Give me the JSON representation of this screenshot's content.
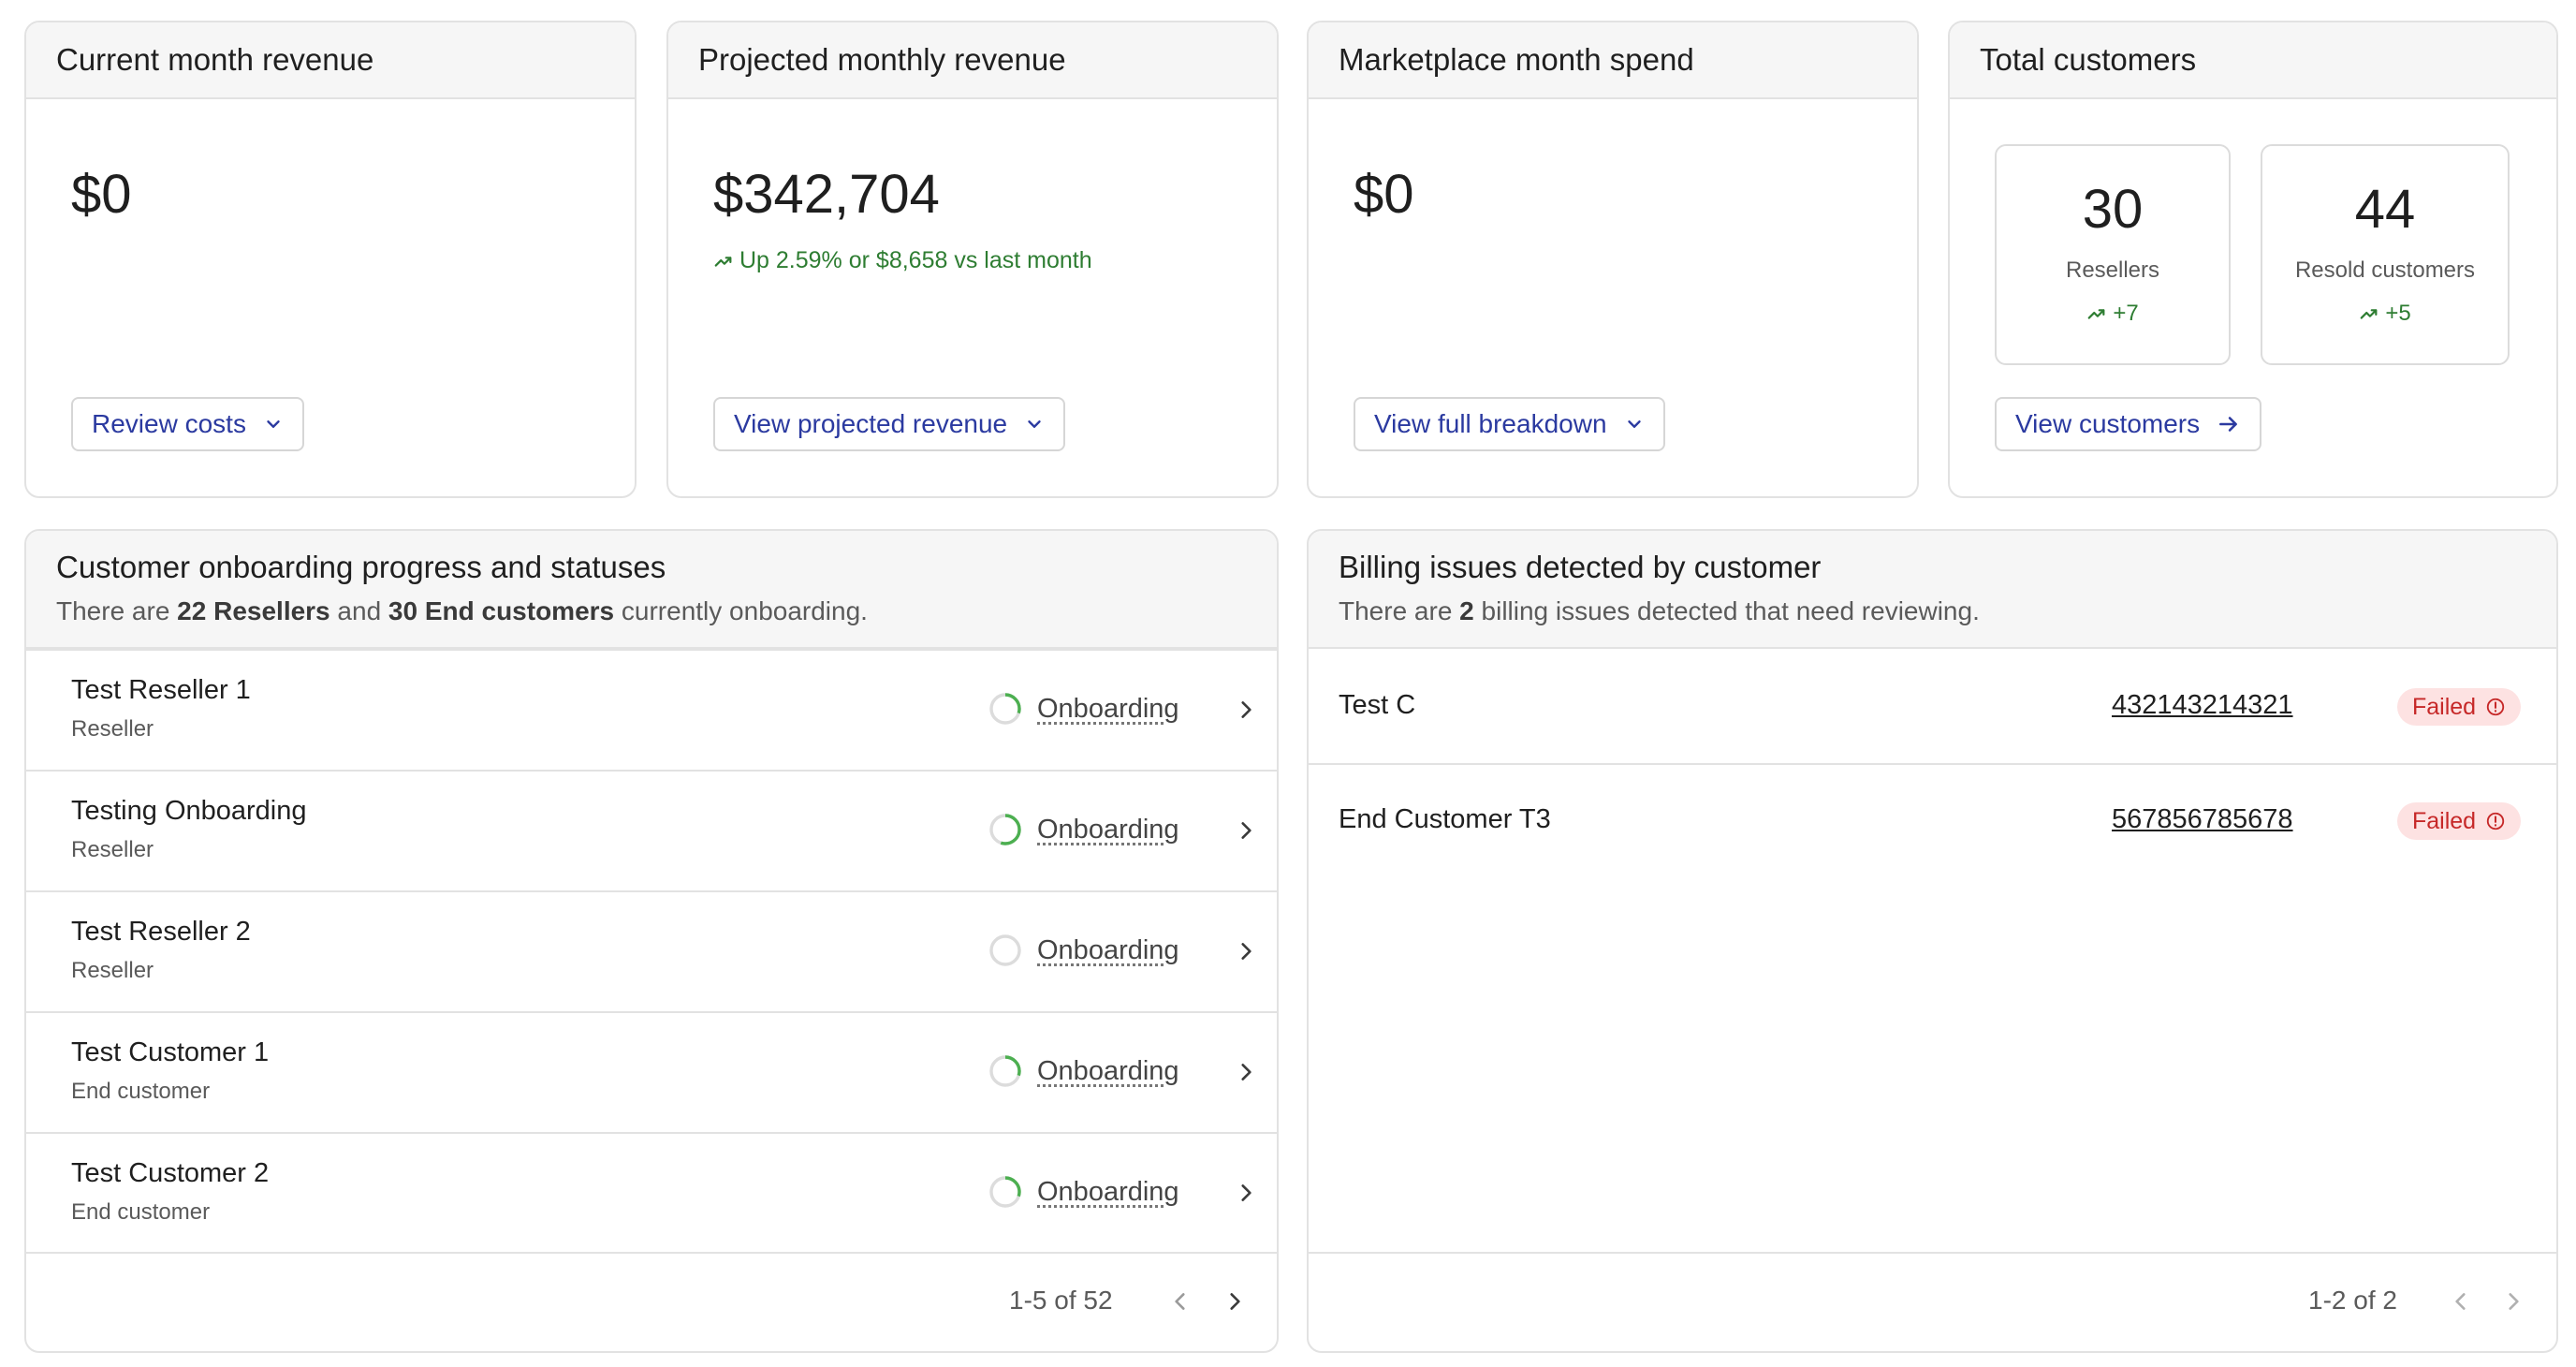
{
  "cards": {
    "current_revenue": {
      "title": "Current month revenue",
      "value": "$0",
      "button_label": "Review costs"
    },
    "projected_revenue": {
      "title": "Projected monthly revenue",
      "value": "$342,704",
      "trend": "Up 2.59% or $8,658 vs last month",
      "button_label": "View projected revenue"
    },
    "marketplace_spend": {
      "title": "Marketplace month spend",
      "value": "$0",
      "button_label": "View full breakdown"
    },
    "total_customers": {
      "title": "Total customers",
      "resellers": {
        "value": "30",
        "label": "Resellers",
        "delta": "+7"
      },
      "resold": {
        "value": "44",
        "label": "Resold customers",
        "delta": "+5"
      },
      "button_label": "View customers"
    }
  },
  "onboarding": {
    "title": "Customer onboarding progress and statuses",
    "subtitle": {
      "p1": "There are ",
      "b1": "22 Resellers",
      "p2": " and ",
      "b2": "30 End customers",
      "p3": " currently onboarding."
    },
    "rows": [
      {
        "name": "Test Reseller 1",
        "type": "Reseller",
        "status": "Onboarding",
        "progress": 0.3
      },
      {
        "name": "Testing Onboarding",
        "type": "Reseller",
        "status": "Onboarding",
        "progress": 0.55
      },
      {
        "name": "Test Reseller 2",
        "type": "Reseller",
        "status": "Onboarding",
        "progress": 0.0
      },
      {
        "name": "Test Customer 1",
        "type": "End customer",
        "status": "Onboarding",
        "progress": 0.3
      },
      {
        "name": "Test Customer 2",
        "type": "End customer",
        "status": "Onboarding",
        "progress": 0.3
      }
    ],
    "pagination": "1-5 of 52"
  },
  "billing": {
    "title": "Billing issues detected by customer",
    "subtitle": {
      "p1": "There are ",
      "b1": "2",
      "p2": " billing issues detected that need reviewing."
    },
    "rows": [
      {
        "name": "Test C",
        "id": "432143214321",
        "status": "Failed"
      },
      {
        "name": "End Customer T3",
        "id": "567856785678",
        "status": "Failed"
      }
    ],
    "pagination": "1-2 of 2"
  },
  "colors": {
    "accent_blue": "#2b3aa0",
    "success_green": "#2e7d32",
    "progress_green": "#4caf50",
    "error_red": "#c62828",
    "error_bg": "#fde2e2"
  },
  "icons": {
    "dropdown": "chevron-down-icon",
    "arrow": "arrow-right-icon",
    "trend": "trending-up-icon",
    "row_nav": "chevron-right-icon",
    "badge": "info-circle-icon"
  }
}
